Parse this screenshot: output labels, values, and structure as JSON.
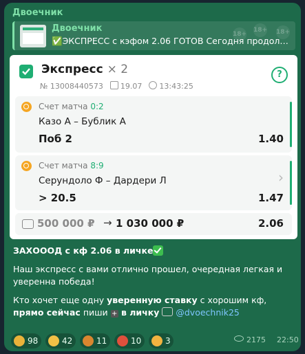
{
  "channel": {
    "sender": "Двоечник"
  },
  "reply": {
    "name": "Двоечник",
    "text": "✅ЭКСПРЕСС с кэфом 2.06 ГОТОВ  Сегодня продолжае..."
  },
  "card": {
    "title": "Экспресс",
    "multiplier": "× 2",
    "ticket": "№ 13008440573",
    "date": "19.07",
    "time": "13:43:25",
    "help_label": "?",
    "events": [
      {
        "score_label": "Счет матча",
        "score": "0:2",
        "teams": "Казо А – Бублик А",
        "pick": "Поб 2",
        "odd": "1.40"
      },
      {
        "score_label": "Счет матча",
        "score": "8:9",
        "teams": "Серундоло Ф – Дардери Л",
        "pick": "> 20.5",
        "odd": "1.47"
      }
    ],
    "summary": {
      "stake": "500 000 ₽",
      "arrow": "→",
      "win": "1 030 000 ₽",
      "total_odd": "2.06"
    }
  },
  "caption": {
    "line1": "ЗАХОООД с кф 2.06 в личке",
    "p2": "Наш экспресс с вами отлично прошел, очередная легкая и уверенна победа!",
    "p3_a": "Кто хочет еще одну ",
    "p3_b": "уверенную ставку",
    "p3_c": " с хорошим кф, ",
    "p3_d": "прямо сейчас",
    "p3_e": " пиши ",
    "p3_f": " в личку",
    "p3_link": "@dvoechnik25"
  },
  "reactions": [
    {
      "icon": "cool-face-icon",
      "count": "98",
      "color": "#e9b23a"
    },
    {
      "icon": "laugh-face-icon",
      "count": "42",
      "color": "#f0c046"
    },
    {
      "icon": "cucumber-face-icon",
      "count": "11",
      "color": "#d9862f"
    },
    {
      "icon": "popcorn-icon",
      "count": "10",
      "color": "#e0503c"
    },
    {
      "icon": "lol-face-icon",
      "count": "3",
      "color": "#f2b340"
    }
  ],
  "footer": {
    "views": "2175",
    "time": "22:50"
  },
  "colors": {
    "accent": "#1fae73",
    "bubble": "#1d6a4a",
    "link": "#7fc6ff"
  }
}
